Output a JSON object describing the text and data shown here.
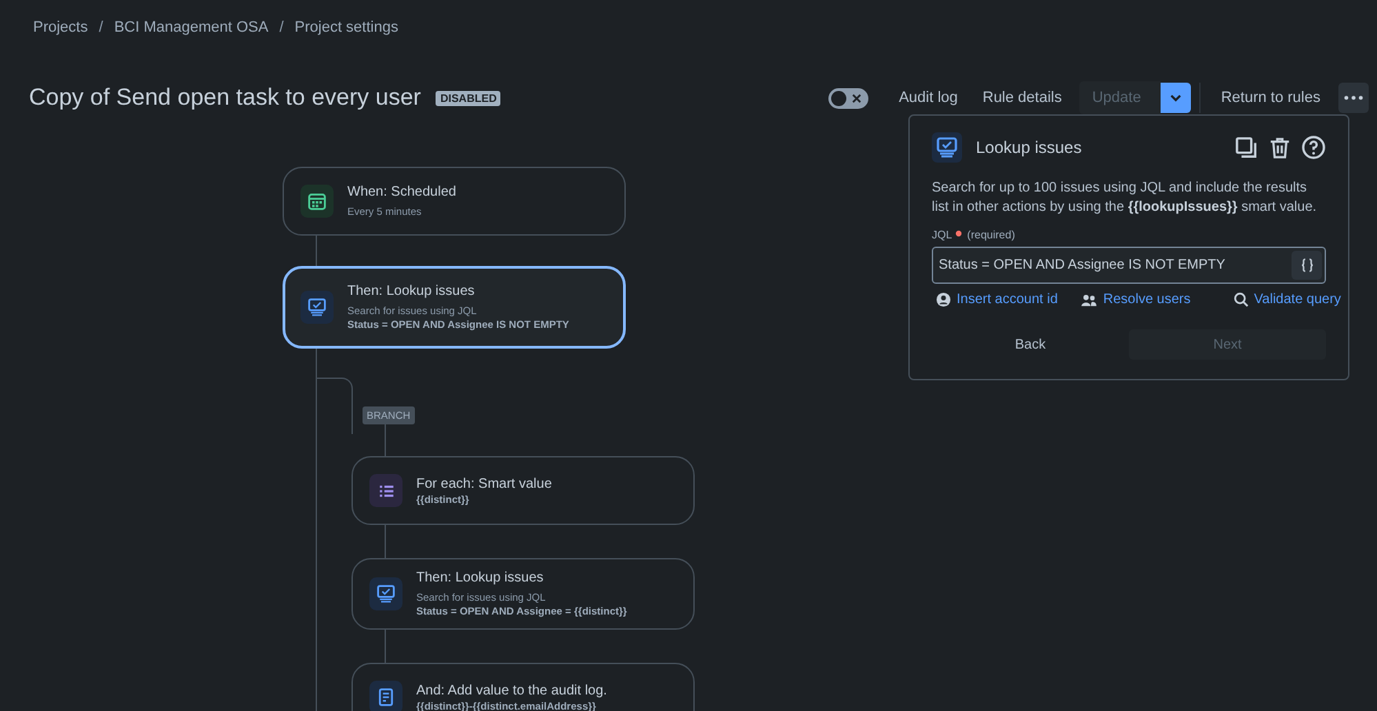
{
  "breadcrumbs": [
    "Projects",
    "BCI Management OSA",
    "Project settings"
  ],
  "breadcrumb_separator": "/",
  "rule": {
    "title": "Copy of Send open task to every user",
    "status": "DISABLED"
  },
  "toolbar": {
    "enabled": false,
    "audit_log": "Audit log",
    "rule_details": "Rule details",
    "update": "Update",
    "return": "Return to rules"
  },
  "flow": [
    {
      "kind": "trigger",
      "title": "When: Scheduled",
      "subtitle": "Every 5 minutes",
      "selected": false
    },
    {
      "kind": "lookup",
      "title": "Then: Lookup issues",
      "subtitle": "Search for issues using JQL",
      "detail": "Status = OPEN AND Assignee IS NOT EMPTY",
      "selected": true
    },
    {
      "kind": "branch",
      "label": "BRANCH",
      "children": [
        {
          "kind": "foreach",
          "title": "For each: Smart value",
          "detail": "{{distinct}}",
          "selected": false
        },
        {
          "kind": "lookup",
          "title": "Then: Lookup issues",
          "subtitle": "Search for issues using JQL",
          "detail": "Status = OPEN AND Assignee = {{distinct}}",
          "selected": false
        },
        {
          "kind": "log",
          "title": "And: Add value to the audit log.",
          "detail": "{{distinct}}-{{distinct.emailAddress}}",
          "selected": false
        }
      ]
    }
  ],
  "panel": {
    "title": "Lookup issues",
    "description": "Search for up to 100 issues using JQL and include the results list in other actions by using the **{{lookupIssues}}** smart value.",
    "field_label": "JQL",
    "required": "(required)",
    "value": "Status = OPEN AND Assignee IS NOT EMPTY",
    "links": [
      "Insert account id",
      "Resolve users",
      "Validate query"
    ],
    "back": "Back",
    "next": "Next"
  }
}
